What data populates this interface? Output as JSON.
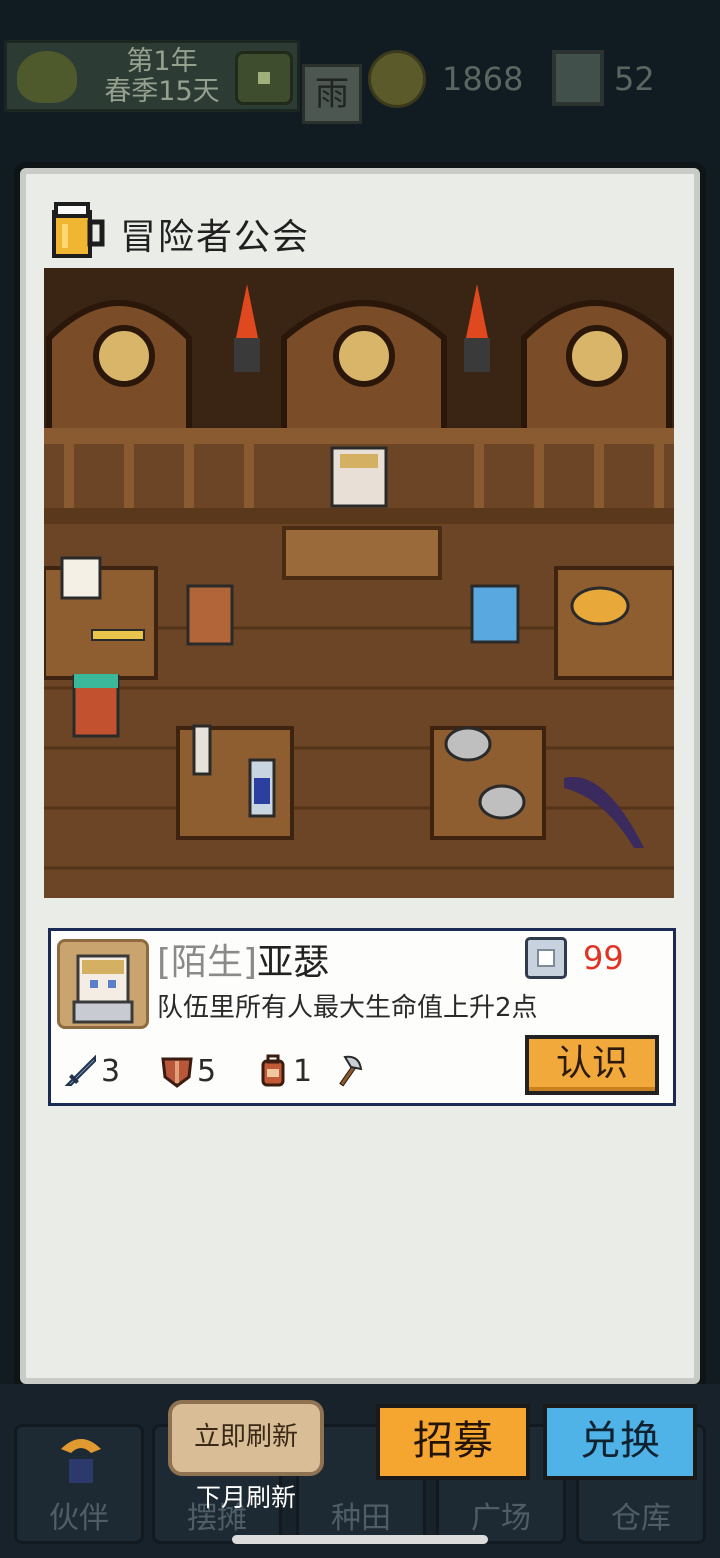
{
  "hud": {
    "year": "第1年",
    "season_day": "春季15天",
    "weather": "雨",
    "gold": "1868",
    "gems": "52"
  },
  "panel": {
    "title": "冒险者公会",
    "title_icon": "beer-mug-icon"
  },
  "candidate": {
    "relation": "[陌生]",
    "name": "亚瑟",
    "cost": "99",
    "description": "队伍里所有人最大生命值上升2点",
    "stats": [
      {
        "icon": "sword-icon",
        "value": "3"
      },
      {
        "icon": "shield-icon",
        "value": "5"
      },
      {
        "icon": "backpack-icon",
        "value": "1"
      },
      {
        "icon": "axe-icon",
        "value": ""
      }
    ],
    "meet_label": "认识"
  },
  "actions": {
    "refresh_now": "立即刷新",
    "refresh_next": "下月刷新",
    "recruit": "招募",
    "exchange": "兑换"
  },
  "nav": {
    "tabs": [
      "伙伴",
      "摆摊",
      "种田",
      "广场",
      "仓库"
    ]
  },
  "colors": {
    "recruit_button": "#f4a631",
    "exchange_button": "#4fb3e8",
    "cost_text": "#e03324",
    "card_border": "#1a2a55"
  }
}
